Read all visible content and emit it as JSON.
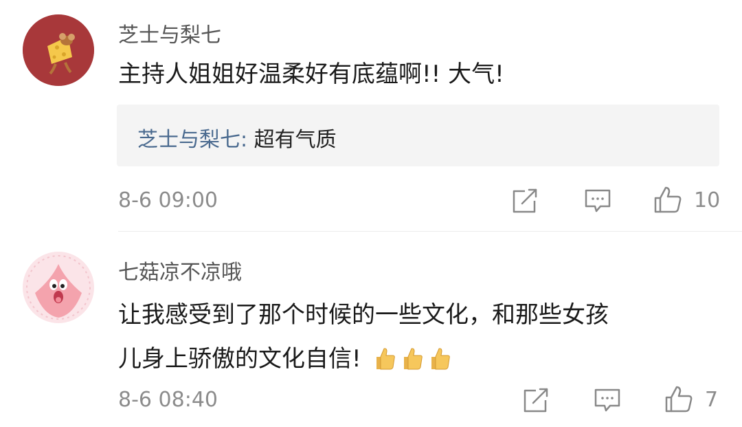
{
  "comments": [
    {
      "username": "芝士与梨七",
      "avatar_icon": "jerry-mouse-cheese-avatar",
      "text": "主持人姐姐好温柔好有底蕴啊!! 大气!",
      "reply": {
        "author": "芝士与梨七:",
        "text": "超有气质"
      },
      "timestamp": "8-6 09:00",
      "likes": "10"
    },
    {
      "username": "七菇凉不凉哦",
      "avatar_icon": "patrick-star-avatar",
      "text_line1": "让我感受到了那个时候的一些文化，和那些女孩",
      "text_line2": "儿身上骄傲的文化自信!",
      "emojis": [
        "thumbs-up-emoji",
        "thumbs-up-emoji",
        "thumbs-up-emoji"
      ],
      "timestamp": "8-6 08:40",
      "likes": "7"
    }
  ],
  "colors": {
    "reply_author": "#4a6a8f",
    "timestamp": "#8c8c8c",
    "reply_bg": "#f4f4f4"
  }
}
